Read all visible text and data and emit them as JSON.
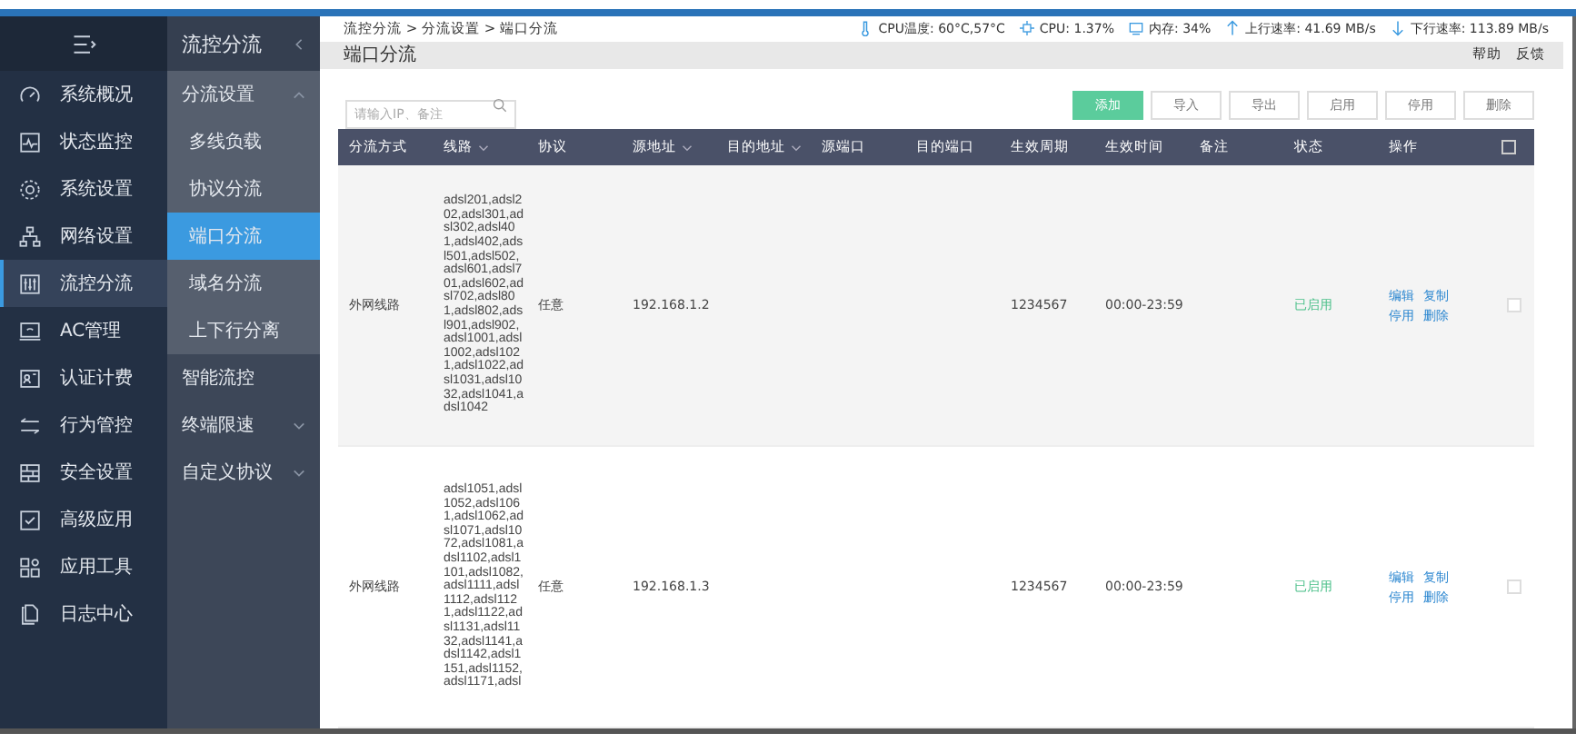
{
  "nav": {
    "items": [
      {
        "label": "系统概况",
        "selected": false
      },
      {
        "label": "状态监控",
        "selected": false
      },
      {
        "label": "系统设置",
        "selected": false
      },
      {
        "label": "网络设置",
        "selected": false
      },
      {
        "label": "流控分流",
        "selected": true
      },
      {
        "label": "AC管理",
        "selected": false
      },
      {
        "label": "认证计费",
        "selected": false
      },
      {
        "label": "行为管控",
        "selected": false
      },
      {
        "label": "安全设置",
        "selected": false
      },
      {
        "label": "高级应用",
        "selected": false
      },
      {
        "label": "应用工具",
        "selected": false
      },
      {
        "label": "日志中心",
        "selected": false
      }
    ]
  },
  "subnav": {
    "title": "流控分流",
    "groups": [
      {
        "kind": "group",
        "label": "分流设置",
        "expanded": true,
        "children": [
          {
            "label": "多线负载",
            "selected": false
          },
          {
            "label": "协议分流",
            "selected": false
          },
          {
            "label": "端口分流",
            "selected": true
          },
          {
            "label": "域名分流",
            "selected": false
          },
          {
            "label": "上下行分离",
            "selected": false
          }
        ]
      },
      {
        "kind": "link",
        "label": "智能流控"
      },
      {
        "kind": "group",
        "label": "终端限速",
        "expanded": false
      },
      {
        "kind": "group",
        "label": "自定义协议",
        "expanded": false
      }
    ]
  },
  "topbar": {
    "breadcrumb": "流控分流 > 分流设置 > 端口分流",
    "stats": [
      {
        "kind": "temp",
        "text": "CPU温度: 60°C,57°C"
      },
      {
        "kind": "cpu",
        "text": "CPU: 1.37%"
      },
      {
        "kind": "memory",
        "text": "内存: 34%"
      },
      {
        "kind": "up",
        "text": "上行速率: 41.69 MB/s"
      },
      {
        "kind": "down",
        "text": "下行速率: 113.89 MB/s"
      }
    ]
  },
  "page": {
    "title": "端口分流",
    "links": [
      "帮助",
      "反馈"
    ]
  },
  "search": {
    "placeholder": "请输入IP、备注"
  },
  "buttons": [
    {
      "label": "添加",
      "kind": "primary"
    },
    {
      "label": "导入",
      "kind": "default"
    },
    {
      "label": "导出",
      "kind": "default"
    },
    {
      "label": "启用",
      "kind": "default"
    },
    {
      "label": "停用",
      "kind": "default"
    },
    {
      "label": "删除",
      "kind": "default"
    }
  ],
  "table": {
    "columns": [
      {
        "label": "分流方式",
        "sortable": false
      },
      {
        "label": "线路",
        "sortable": true
      },
      {
        "label": "协议",
        "sortable": false
      },
      {
        "label": "源地址",
        "sortable": true
      },
      {
        "label": "目的地址",
        "sortable": true
      },
      {
        "label": "源端口",
        "sortable": false
      },
      {
        "label": "目的端口",
        "sortable": false
      },
      {
        "label": "生效周期",
        "sortable": false
      },
      {
        "label": "生效时间",
        "sortable": false
      },
      {
        "label": "备注",
        "sortable": false
      },
      {
        "label": "状态",
        "sortable": false
      },
      {
        "label": "操作",
        "sortable": false
      }
    ],
    "all_checked": false,
    "rows": [
      {
        "method": "外网线路",
        "lines": "adsl201,adsl202,adsl301,adsl302,adsl401,adsl402,adsl501,adsl502,adsl601,adsl701,adsl602,adsl702,adsl801,adsl802,adsl901,adsl902,adsl1001,adsl1002,adsl1021,adsl1022,adsl1031,adsl1032,adsl1041,adsl1042",
        "protocol": "任意",
        "src": "192.168.1.2",
        "period": "1234567",
        "time": "00:00-23:59",
        "status": "已启用",
        "actions": [
          "编辑",
          "复制",
          "停用",
          "删除"
        ],
        "checked": false
      },
      {
        "method": "外网线路",
        "lines": "adsl1051,adsl1052,adsl1061,adsl1062,adsl1071,adsl1072,adsl1081,adsl1102,adsl1101,adsl1082,adsl1111,adsl1112,adsl1121,adsl1122,adsl1131,adsl1132,adsl1141,adsl1142,adsl1151,adsl1152,adsl1171,adsl",
        "protocol": "任意",
        "src": "192.168.1.3",
        "period": "1234567",
        "time": "00:00-23:59",
        "status": "已启用",
        "actions": [
          "编辑",
          "复制",
          "停用",
          "删除"
        ],
        "checked": false
      }
    ]
  }
}
